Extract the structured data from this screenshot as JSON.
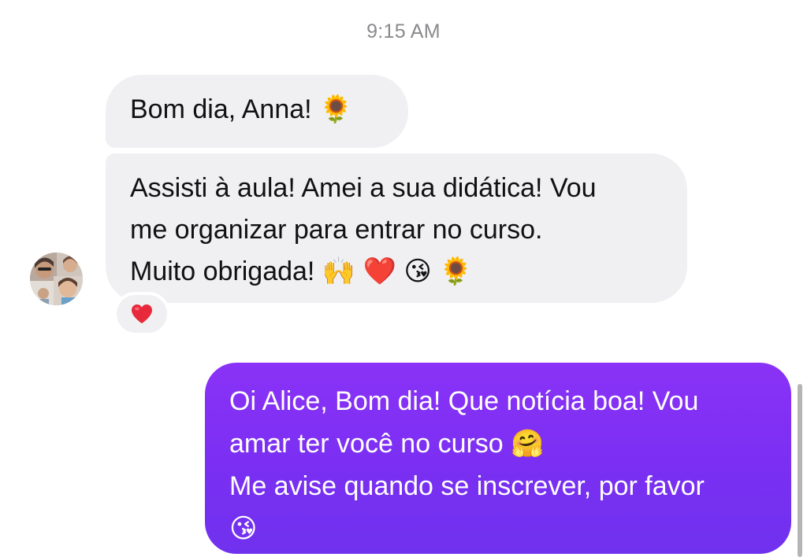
{
  "conversation": {
    "timestamp": "9:15 AM",
    "messages_incoming": [
      {
        "lines": [
          "Bom dia, Anna! 🌻"
        ]
      },
      {
        "lines": [
          "Assisti à aula! Amei a sua didática! Vou",
          "me organizar para entrar no curso.",
          "Muito obrigada! 🙌 ❤️ 😘 🌻"
        ],
        "reaction": "❤️"
      }
    ],
    "message_outgoing": {
      "lines": [
        "Oi Alice, Bom dia! Que notícia boa! Vou",
        "amar ter você no curso 🤗",
        "Me avise quando se inscrever, por favor",
        "😘"
      ]
    }
  },
  "colors": {
    "incoming_bubble": "#f0f0f3",
    "outgoing_bubble": "#7a2ff2",
    "timestamp_text": "#8a8a8e",
    "reaction_heart": "#e8283b"
  },
  "icons": {
    "avatar": "contact-photo",
    "reaction": "heart-icon"
  }
}
